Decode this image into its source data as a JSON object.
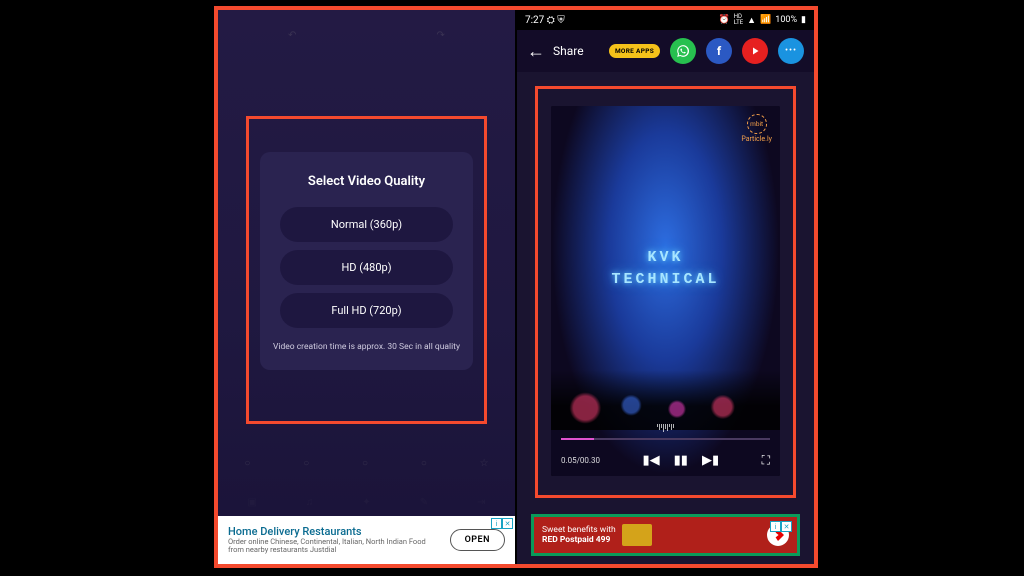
{
  "left": {
    "dialog": {
      "title": "Select Video Quality",
      "options": [
        "Normal (360p)",
        "HD (480p)",
        "Full HD (720p)"
      ],
      "note": "Video creation time is approx. 30 Sec in all quality"
    },
    "ad": {
      "title": "Home Delivery Restaurants",
      "desc": "Order online Chinese, Continental, Italian, North Indian Food from nearby restaurants Justdial",
      "cta": "OPEN",
      "badge_info": "i",
      "badge_close": "✕"
    }
  },
  "right": {
    "status": {
      "time": "7:27",
      "battery": "100%"
    },
    "share": {
      "label": "Share",
      "more_apps": "MORE APPS"
    },
    "video": {
      "brand_name": "mbit",
      "brand_sub": "Particle.ly",
      "overlay_line1": "KVK",
      "overlay_line2": "TECHNICAL",
      "time_elapsed": "0.05",
      "time_total": "00.30"
    },
    "ad": {
      "line1": "Sweet benefits with",
      "line2": "RED Postpaid 499",
      "badge_info": "i",
      "badge_close": "✕"
    }
  }
}
